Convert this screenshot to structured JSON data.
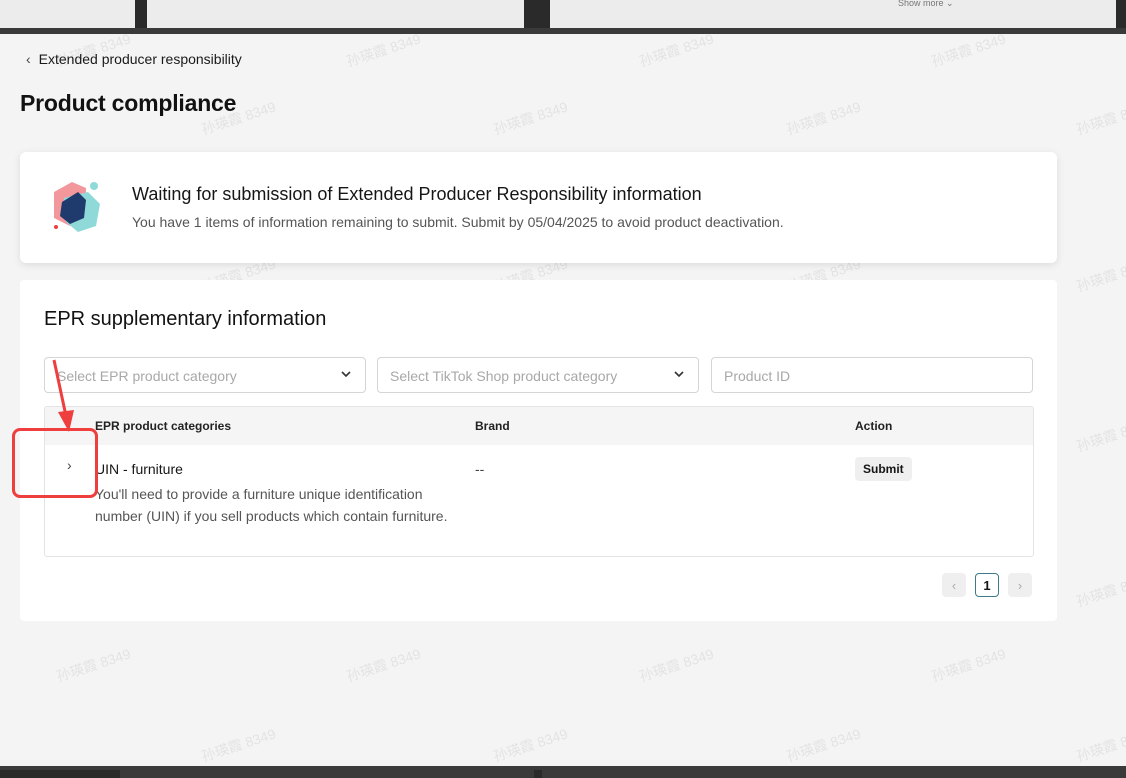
{
  "top_strip": {
    "show_more": "Show more ⌄"
  },
  "nav": {
    "back_label": "Extended producer responsibility"
  },
  "page": {
    "title": "Product compliance"
  },
  "banner": {
    "title": "Waiting for submission of Extended Producer Responsibility information",
    "description": "You have 1 items of information remaining to submit. Submit by 05/04/2025 to avoid product deactivation."
  },
  "epr": {
    "title": "EPR supplementary information",
    "filters": {
      "epr_category_placeholder": "Select EPR product category",
      "tiktok_category_placeholder": "Select TikTok Shop product category",
      "product_id_placeholder": "Product ID"
    },
    "table": {
      "headers": {
        "category": "EPR product categories",
        "brand": "Brand",
        "action": "Action"
      },
      "rows": [
        {
          "name": "UIN - furniture",
          "description": "You'll need to provide a furniture unique identification number (UIN) if you sell products which contain furniture.",
          "brand": "--",
          "action": "Submit"
        }
      ]
    },
    "pagination": {
      "current_page": "1"
    }
  },
  "watermark": "孙瑛霞 8349",
  "colors": {
    "accent": "#3b7c86",
    "annotation": "#ef3e3e"
  }
}
